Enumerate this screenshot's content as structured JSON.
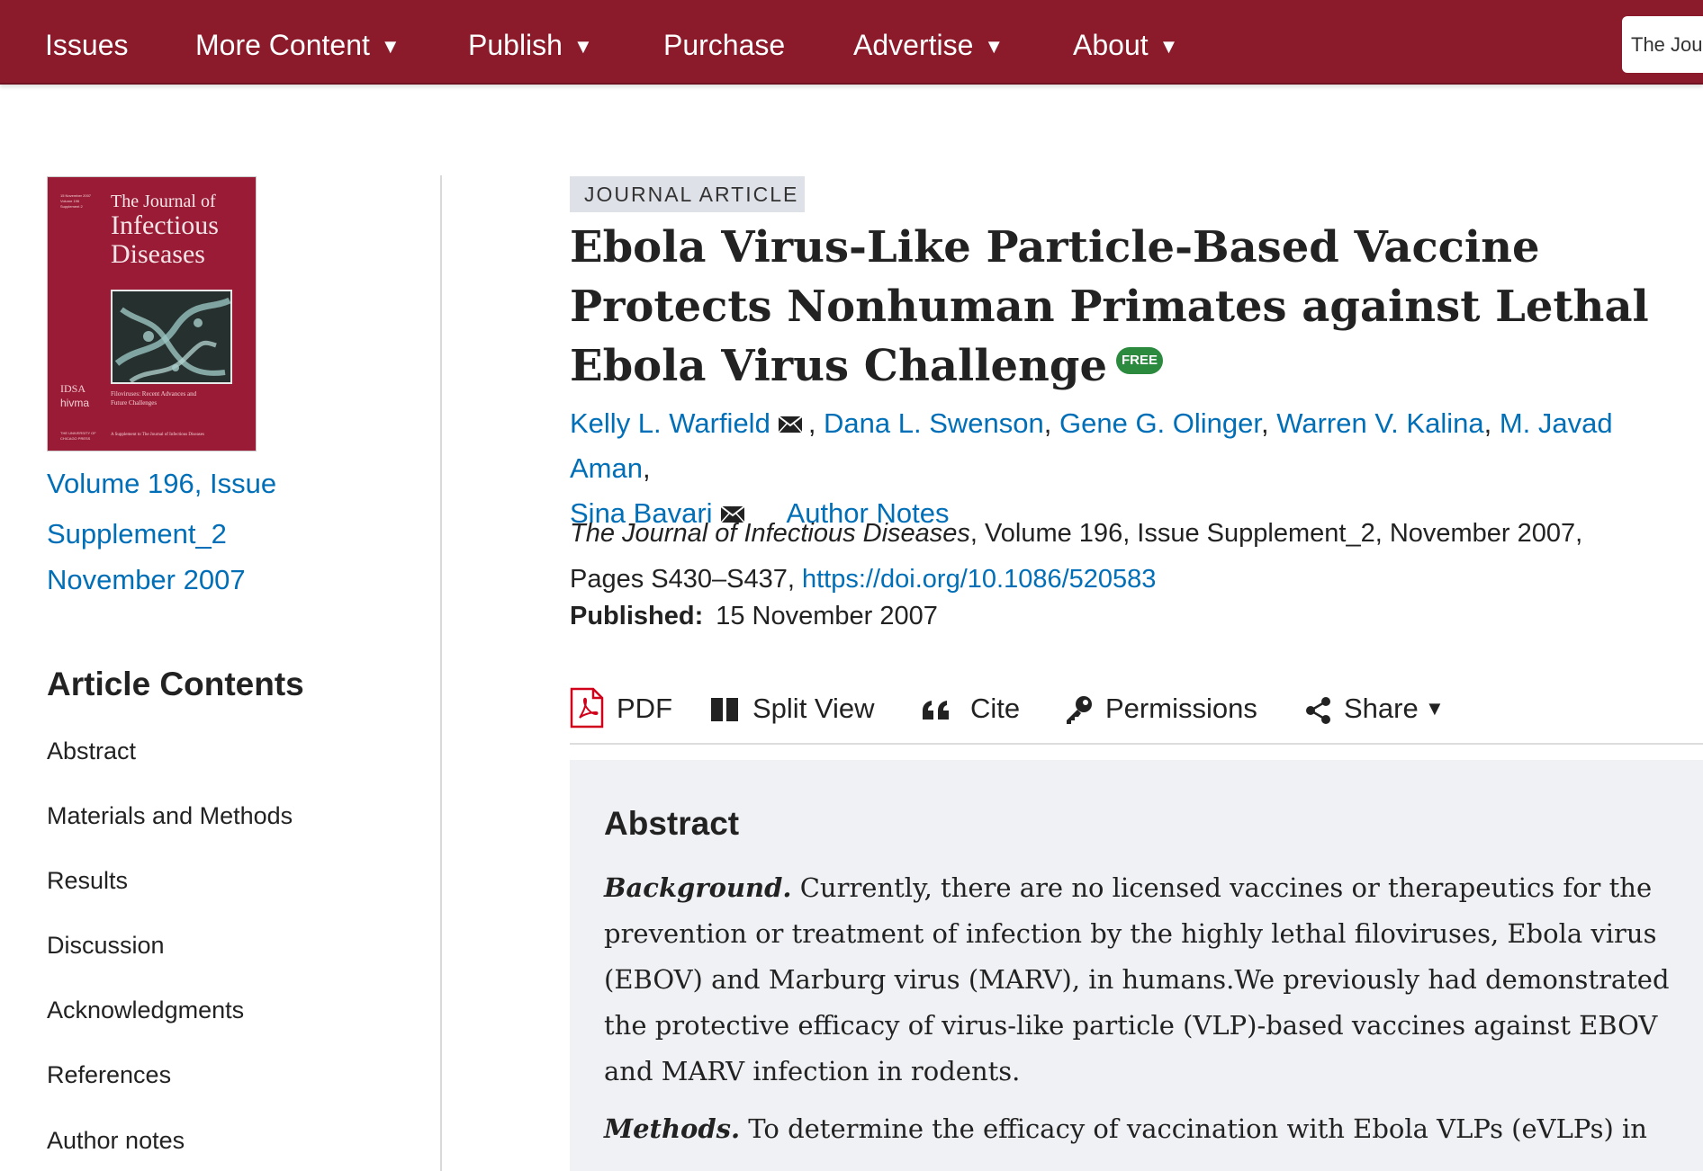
{
  "nav": {
    "items": [
      {
        "label": "Issues",
        "dropdown": false
      },
      {
        "label": "More Content",
        "dropdown": true
      },
      {
        "label": "Publish",
        "dropdown": true
      },
      {
        "label": "Purchase",
        "dropdown": false
      },
      {
        "label": "Advertise",
        "dropdown": true
      },
      {
        "label": "About",
        "dropdown": true
      }
    ],
    "caret": "▼",
    "search_text": "The Jou"
  },
  "cover": {
    "small_text": "15 November 2007 Volume 196 Supplement 2",
    "title_line1": "The Journal of",
    "title_line2": "Infectious Diseases",
    "logo1": "IDSA",
    "logo2": "hivma",
    "subtitle": "Filoviruses: Recent Advances and Future Challenges",
    "footer": "A Supplement to The Journal of Infectious Diseases",
    "footer_left": "THE UNIVERSITY OF CHICAGO PRESS"
  },
  "issue": {
    "line1": "Volume 196, Issue",
    "line2": "Supplement_2",
    "line3": "November 2007"
  },
  "contents": {
    "title": "Article Contents",
    "items": [
      "Abstract",
      "Materials and Methods",
      "Results",
      "Discussion",
      "Acknowledgments",
      "References",
      "Author notes"
    ]
  },
  "article": {
    "type": "JOURNAL ARTICLE",
    "title": "Ebola Virus-Like Particle-Based Vaccine Protects Nonhuman Primates against Lethal Ebola Virus Challenge",
    "free_badge": "FREE",
    "authors": [
      "Kelly L. Warfield",
      "Dana L. Swenson",
      "Gene G. Olinger",
      "Warren V. Kalina",
      "M. Javad Aman",
      "Sina Bavari"
    ],
    "author_notes": "Author Notes",
    "journal_name": "The Journal of Infectious Diseases",
    "citation_rest": ", Volume 196, Issue Supplement_2, November 2007,",
    "pages": "Pages S430–S437,",
    "doi": "https://doi.org/10.1086/520583",
    "published_label": "Published:",
    "published_date": "15 November 2007"
  },
  "toolbar": {
    "pdf": "PDF",
    "split_view": "Split View",
    "cite": "Cite",
    "permissions": "Permissions",
    "share": "Share",
    "share_caret": "▼"
  },
  "abstract": {
    "title": "Abstract",
    "background_lead": "Background.",
    "background_text": " Currently, there are no licensed vaccines or therapeutics for the prevention or treatment of infection by the highly lethal filoviruses, Ebola virus (EBOV) and Marburg virus (MARV), in humans.We previously had demonstrated the protective efficacy of virus-like particle (VLP)-based vaccines against EBOV and MARV infection in rodents.",
    "methods_lead": "Methods.",
    "methods_text": " To determine the efficacy of vaccination with Ebola VLPs (eVLPs) in"
  },
  "colors": {
    "nav_bg": "#8b1a2b",
    "link": "#006fb7",
    "badge_bg": "#dfe1e8",
    "free_badge": "#2b8a3e",
    "abstract_bg": "#f0f1f4",
    "pdf_red": "#d0021b"
  },
  "icons": {
    "author_email": "envelope-icon",
    "pdf": "pdf-file-icon",
    "split_view": "split-view-icon",
    "cite": "quote-icon",
    "permissions": "key-icon",
    "share": "share-icon"
  }
}
